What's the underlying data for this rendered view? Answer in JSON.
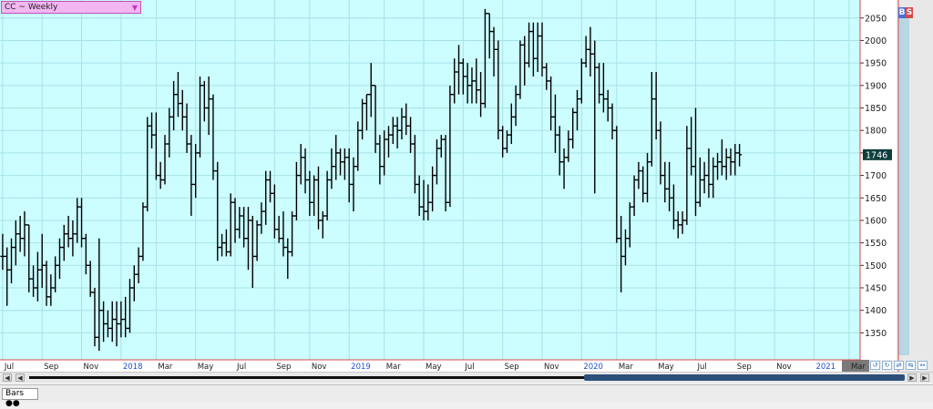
{
  "symbol": {
    "label": "CC ~ Weekly",
    "dropdown_icon": "triangle-down-icon"
  },
  "bs_buttons": {
    "buy": "B",
    "sell": "S"
  },
  "colors": {
    "plot_bg": "#ccfdff",
    "bar": "#000000",
    "grid": "#a8e2e6",
    "separator": "#e24848",
    "year_label": "#2050d0",
    "price_tag": "#0f3d3d",
    "scroll_thumb": "#2d4f7a"
  },
  "status": {
    "tab_label": "Bars"
  },
  "chart_data": {
    "type": "ohlc",
    "title": "CC ~ Weekly",
    "ylim": [
      1290,
      2090
    ],
    "y_ticks": [
      1350,
      1400,
      1450,
      1500,
      1550,
      1600,
      1650,
      1700,
      1750,
      1800,
      1850,
      1900,
      1950,
      2000,
      2050
    ],
    "last_price": 1746,
    "grid": true,
    "x_labels": [
      {
        "i": 0,
        "label": "Jul",
        "year": false
      },
      {
        "i": 9,
        "label": "Sep",
        "year": false
      },
      {
        "i": 18,
        "label": "Nov",
        "year": false
      },
      {
        "i": 27,
        "label": "2018",
        "year": true
      },
      {
        "i": 35,
        "label": "Mar",
        "year": false
      },
      {
        "i": 44,
        "label": "May",
        "year": false
      },
      {
        "i": 53,
        "label": "Jul",
        "year": false
      },
      {
        "i": 62,
        "label": "Sep",
        "year": false
      },
      {
        "i": 70,
        "label": "Nov",
        "year": false
      },
      {
        "i": 79,
        "label": "2019",
        "year": true
      },
      {
        "i": 87,
        "label": "Mar",
        "year": false
      },
      {
        "i": 96,
        "label": "May",
        "year": false
      },
      {
        "i": 105,
        "label": "Jul",
        "year": false
      },
      {
        "i": 114,
        "label": "Sep",
        "year": false
      },
      {
        "i": 123,
        "label": "Nov",
        "year": false
      },
      {
        "i": 132,
        "label": "2020",
        "year": true
      },
      {
        "i": 140,
        "label": "Mar",
        "year": false
      },
      {
        "i": 149,
        "label": "May",
        "year": false
      },
      {
        "i": 158,
        "label": "Jul",
        "year": false
      },
      {
        "i": 167,
        "label": "Sep",
        "year": false
      },
      {
        "i": 176,
        "label": "Nov",
        "year": false
      },
      {
        "i": 185,
        "label": "2021",
        "year": true
      },
      {
        "i": 193,
        "label": "Mar",
        "year": false
      }
    ],
    "bars": [
      [
        1520,
        1570,
        1490,
        1520
      ],
      [
        1520,
        1540,
        1410,
        1490
      ],
      [
        1490,
        1560,
        1460,
        1540
      ],
      [
        1540,
        1600,
        1500,
        1570
      ],
      [
        1570,
        1610,
        1530,
        1560
      ],
      [
        1560,
        1620,
        1520,
        1590
      ],
      [
        1590,
        1590,
        1440,
        1470
      ],
      [
        1470,
        1500,
        1430,
        1450
      ],
      [
        1450,
        1530,
        1420,
        1490
      ],
      [
        1490,
        1570,
        1450,
        1500
      ],
      [
        1500,
        1510,
        1410,
        1430
      ],
      [
        1430,
        1480,
        1410,
        1450
      ],
      [
        1450,
        1520,
        1440,
        1500
      ],
      [
        1500,
        1560,
        1470,
        1540
      ],
      [
        1540,
        1590,
        1510,
        1570
      ],
      [
        1570,
        1610,
        1540,
        1560
      ],
      [
        1560,
        1600,
        1520,
        1570
      ],
      [
        1570,
        1650,
        1550,
        1630
      ],
      [
        1630,
        1650,
        1540,
        1560
      ],
      [
        1560,
        1570,
        1480,
        1500
      ],
      [
        1500,
        1510,
        1430,
        1440
      ],
      [
        1440,
        1450,
        1320,
        1340
      ],
      [
        1340,
        1560,
        1310,
        1400
      ],
      [
        1400,
        1420,
        1330,
        1370
      ],
      [
        1370,
        1400,
        1340,
        1360
      ],
      [
        1360,
        1420,
        1330,
        1380
      ],
      [
        1380,
        1420,
        1320,
        1370
      ],
      [
        1370,
        1420,
        1340,
        1380
      ],
      [
        1380,
        1430,
        1340,
        1360
      ],
      [
        1360,
        1470,
        1350,
        1450
      ],
      [
        1450,
        1500,
        1420,
        1480
      ],
      [
        1480,
        1540,
        1460,
        1520
      ],
      [
        1520,
        1640,
        1510,
        1630
      ],
      [
        1630,
        1830,
        1620,
        1810
      ],
      [
        1810,
        1840,
        1760,
        1790
      ],
      [
        1790,
        1840,
        1690,
        1700
      ],
      [
        1700,
        1730,
        1670,
        1690
      ],
      [
        1690,
        1790,
        1680,
        1770
      ],
      [
        1770,
        1850,
        1740,
        1830
      ],
      [
        1830,
        1910,
        1800,
        1880
      ],
      [
        1880,
        1930,
        1830,
        1860
      ],
      [
        1860,
        1890,
        1800,
        1830
      ],
      [
        1830,
        1860,
        1750,
        1770
      ],
      [
        1770,
        1790,
        1610,
        1680
      ],
      [
        1680,
        1770,
        1650,
        1750
      ],
      [
        1750,
        1920,
        1740,
        1900
      ],
      [
        1900,
        1910,
        1820,
        1850
      ],
      [
        1850,
        1920,
        1790,
        1870
      ],
      [
        1870,
        1880,
        1690,
        1710
      ],
      [
        1710,
        1730,
        1510,
        1540
      ],
      [
        1540,
        1570,
        1520,
        1550
      ],
      [
        1550,
        1580,
        1520,
        1530
      ],
      [
        1530,
        1660,
        1520,
        1640
      ],
      [
        1640,
        1650,
        1550,
        1580
      ],
      [
        1580,
        1630,
        1560,
        1610
      ],
      [
        1610,
        1630,
        1540,
        1560
      ],
      [
        1560,
        1630,
        1490,
        1600
      ],
      [
        1600,
        1610,
        1450,
        1520
      ],
      [
        1520,
        1600,
        1510,
        1590
      ],
      [
        1590,
        1640,
        1570,
        1620
      ],
      [
        1620,
        1710,
        1590,
        1690
      ],
      [
        1690,
        1710,
        1640,
        1660
      ],
      [
        1660,
        1680,
        1560,
        1580
      ],
      [
        1580,
        1610,
        1550,
        1560
      ],
      [
        1560,
        1620,
        1520,
        1540
      ],
      [
        1540,
        1560,
        1470,
        1530
      ],
      [
        1530,
        1620,
        1520,
        1610
      ],
      [
        1610,
        1730,
        1600,
        1700
      ],
      [
        1700,
        1770,
        1680,
        1740
      ],
      [
        1740,
        1760,
        1660,
        1690
      ],
      [
        1690,
        1710,
        1610,
        1640
      ],
      [
        1640,
        1700,
        1610,
        1690
      ],
      [
        1690,
        1720,
        1580,
        1600
      ],
      [
        1600,
        1620,
        1560,
        1610
      ],
      [
        1610,
        1710,
        1600,
        1690
      ],
      [
        1690,
        1760,
        1670,
        1720
      ],
      [
        1720,
        1790,
        1690,
        1750
      ],
      [
        1750,
        1760,
        1700,
        1730
      ],
      [
        1730,
        1760,
        1690,
        1740
      ],
      [
        1740,
        1760,
        1640,
        1680
      ],
      [
        1680,
        1740,
        1620,
        1720
      ],
      [
        1720,
        1820,
        1710,
        1800
      ],
      [
        1800,
        1870,
        1780,
        1860
      ],
      [
        1860,
        1880,
        1800,
        1880
      ],
      [
        1880,
        1950,
        1830,
        1900
      ],
      [
        1900,
        1900,
        1750,
        1770
      ],
      [
        1770,
        1790,
        1680,
        1720
      ],
      [
        1720,
        1800,
        1700,
        1780
      ],
      [
        1780,
        1810,
        1740,
        1790
      ],
      [
        1790,
        1830,
        1770,
        1810
      ],
      [
        1810,
        1830,
        1760,
        1800
      ],
      [
        1800,
        1850,
        1780,
        1830
      ],
      [
        1830,
        1860,
        1790,
        1810
      ],
      [
        1810,
        1830,
        1750,
        1770
      ],
      [
        1770,
        1790,
        1660,
        1680
      ],
      [
        1680,
        1700,
        1610,
        1630
      ],
      [
        1630,
        1690,
        1600,
        1620
      ],
      [
        1620,
        1680,
        1600,
        1640
      ],
      [
        1640,
        1720,
        1620,
        1700
      ],
      [
        1700,
        1780,
        1680,
        1760
      ],
      [
        1760,
        1790,
        1740,
        1780
      ],
      [
        1780,
        1790,
        1620,
        1640
      ],
      [
        1640,
        1900,
        1630,
        1880
      ],
      [
        1880,
        1960,
        1860,
        1930
      ],
      [
        1930,
        1990,
        1880,
        1950
      ],
      [
        1950,
        1960,
        1880,
        1920
      ],
      [
        1920,
        1950,
        1860,
        1900
      ],
      [
        1900,
        1940,
        1860,
        1910
      ],
      [
        1910,
        1960,
        1860,
        1890
      ],
      [
        1890,
        1930,
        1830,
        1860
      ],
      [
        1860,
        2070,
        1850,
        2060
      ],
      [
        2060,
        2060,
        1960,
        2020
      ],
      [
        2020,
        2030,
        1920,
        1980
      ],
      [
        1980,
        2000,
        1780,
        1800
      ],
      [
        1800,
        1810,
        1740,
        1760
      ],
      [
        1760,
        1800,
        1750,
        1790
      ],
      [
        1790,
        1860,
        1770,
        1830
      ],
      [
        1830,
        1900,
        1810,
        1880
      ],
      [
        1880,
        2000,
        1870,
        1990
      ],
      [
        1990,
        2010,
        1900,
        1950
      ],
      [
        1950,
        2040,
        1940,
        2020
      ],
      [
        2020,
        2040,
        1920,
        1960
      ],
      [
        1960,
        2040,
        1930,
        2010
      ],
      [
        2010,
        2040,
        1920,
        1940
      ],
      [
        1940,
        1950,
        1890,
        1910
      ],
      [
        1910,
        1920,
        1800,
        1830
      ],
      [
        1830,
        1880,
        1750,
        1790
      ],
      [
        1790,
        1810,
        1700,
        1730
      ],
      [
        1730,
        1760,
        1670,
        1740
      ],
      [
        1740,
        1800,
        1730,
        1780
      ],
      [
        1780,
        1850,
        1760,
        1840
      ],
      [
        1840,
        1890,
        1800,
        1870
      ],
      [
        1870,
        1960,
        1860,
        1950
      ],
      [
        1950,
        2010,
        1940,
        1980
      ],
      [
        1980,
        2030,
        1920,
        1970
      ],
      [
        1970,
        2000,
        1660,
        1940
      ],
      [
        1940,
        1950,
        1860,
        1880
      ],
      [
        1880,
        1950,
        1840,
        1870
      ],
      [
        1870,
        1890,
        1820,
        1850
      ],
      [
        1850,
        1860,
        1780,
        1800
      ],
      [
        1800,
        1810,
        1550,
        1560
      ],
      [
        1560,
        1610,
        1440,
        1520
      ],
      [
        1520,
        1580,
        1500,
        1560
      ],
      [
        1560,
        1640,
        1540,
        1630
      ],
      [
        1630,
        1700,
        1610,
        1690
      ],
      [
        1690,
        1730,
        1670,
        1710
      ],
      [
        1710,
        1720,
        1640,
        1660
      ],
      [
        1660,
        1750,
        1640,
        1730
      ],
      [
        1730,
        1930,
        1720,
        1870
      ],
      [
        1870,
        1930,
        1780,
        1800
      ],
      [
        1800,
        1820,
        1680,
        1700
      ],
      [
        1700,
        1730,
        1640,
        1670
      ],
      [
        1670,
        1730,
        1620,
        1650
      ],
      [
        1650,
        1680,
        1580,
        1600
      ],
      [
        1600,
        1620,
        1560,
        1590
      ],
      [
        1590,
        1620,
        1570,
        1600
      ],
      [
        1600,
        1810,
        1590,
        1760
      ],
      [
        1760,
        1830,
        1700,
        1720
      ],
      [
        1720,
        1850,
        1610,
        1640
      ],
      [
        1640,
        1740,
        1630,
        1690
      ],
      [
        1690,
        1730,
        1660,
        1700
      ],
      [
        1700,
        1760,
        1650,
        1680
      ],
      [
        1680,
        1740,
        1650,
        1720
      ],
      [
        1720,
        1750,
        1690,
        1730
      ],
      [
        1730,
        1780,
        1700,
        1720
      ],
      [
        1720,
        1760,
        1690,
        1740
      ],
      [
        1740,
        1760,
        1700,
        1730
      ],
      [
        1730,
        1770,
        1700,
        1750
      ],
      [
        1750,
        1770,
        1720,
        1746
      ]
    ],
    "xlim": [
      -0.6,
      195.5
    ]
  }
}
